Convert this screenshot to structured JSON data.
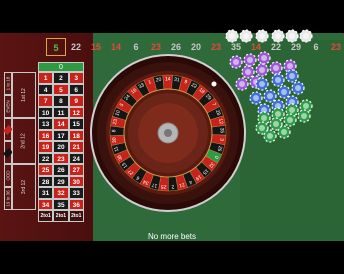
{
  "history": [
    {
      "value": "5",
      "color": "grn",
      "name": "hist-current"
    },
    {
      "value": "22",
      "color": "blk"
    },
    {
      "value": "15",
      "color": "red"
    },
    {
      "value": "14",
      "color": "red"
    },
    {
      "value": "6",
      "color": "blk"
    },
    {
      "value": "23",
      "color": "red"
    },
    {
      "value": "26",
      "color": "blk"
    },
    {
      "value": "20",
      "color": "blk"
    },
    {
      "value": "23",
      "color": "red"
    },
    {
      "value": "35",
      "color": "blk"
    },
    {
      "value": "14",
      "color": "red"
    },
    {
      "value": "22",
      "color": "blk"
    },
    {
      "value": "29",
      "color": "blk"
    },
    {
      "value": "6",
      "color": "blk"
    },
    {
      "value": "23",
      "color": "red"
    }
  ],
  "table": {
    "zero": "0",
    "rows": [
      [
        "1",
        "2",
        "3"
      ],
      [
        "4",
        "5",
        "6"
      ],
      [
        "7",
        "8",
        "9"
      ],
      [
        "10",
        "11",
        "12"
      ],
      [
        "13",
        "14",
        "15"
      ],
      [
        "16",
        "17",
        "18"
      ],
      [
        "19",
        "20",
        "21"
      ],
      [
        "22",
        "23",
        "24"
      ],
      [
        "25",
        "26",
        "27"
      ],
      [
        "28",
        "29",
        "30"
      ],
      [
        "31",
        "32",
        "33"
      ],
      [
        "34",
        "35",
        "36"
      ]
    ],
    "red_numbers": [
      1,
      3,
      5,
      7,
      9,
      12,
      14,
      16,
      18,
      19,
      21,
      23,
      25,
      27,
      30,
      32,
      34,
      36
    ],
    "columns": [
      "2to1",
      "2to1",
      "2to1"
    ],
    "dozens": [
      "1st 12",
      "2nd 12",
      "3rd 12"
    ],
    "outside": [
      "1 to 18",
      "EVEN",
      "RED",
      "BLACK",
      "ODD",
      "19 to 36"
    ]
  },
  "wheel": {
    "numbers": [
      0,
      32,
      15,
      19,
      4,
      21,
      2,
      25,
      17,
      34,
      6,
      27,
      13,
      36,
      11,
      30,
      8,
      23,
      10,
      5,
      24,
      16,
      33,
      1,
      20,
      14,
      31,
      9,
      22,
      18,
      29,
      7,
      28,
      12,
      35,
      3,
      26
    ],
    "winning": "5"
  },
  "chips": [
    {
      "value": "1",
      "color": "#e8e8e8"
    },
    {
      "value": "5",
      "color": "#9b59d6"
    },
    {
      "value": "10",
      "color": "#3f6fd8"
    },
    {
      "value": "25",
      "color": "#2f9e4a"
    }
  ],
  "status": "No more bets"
}
